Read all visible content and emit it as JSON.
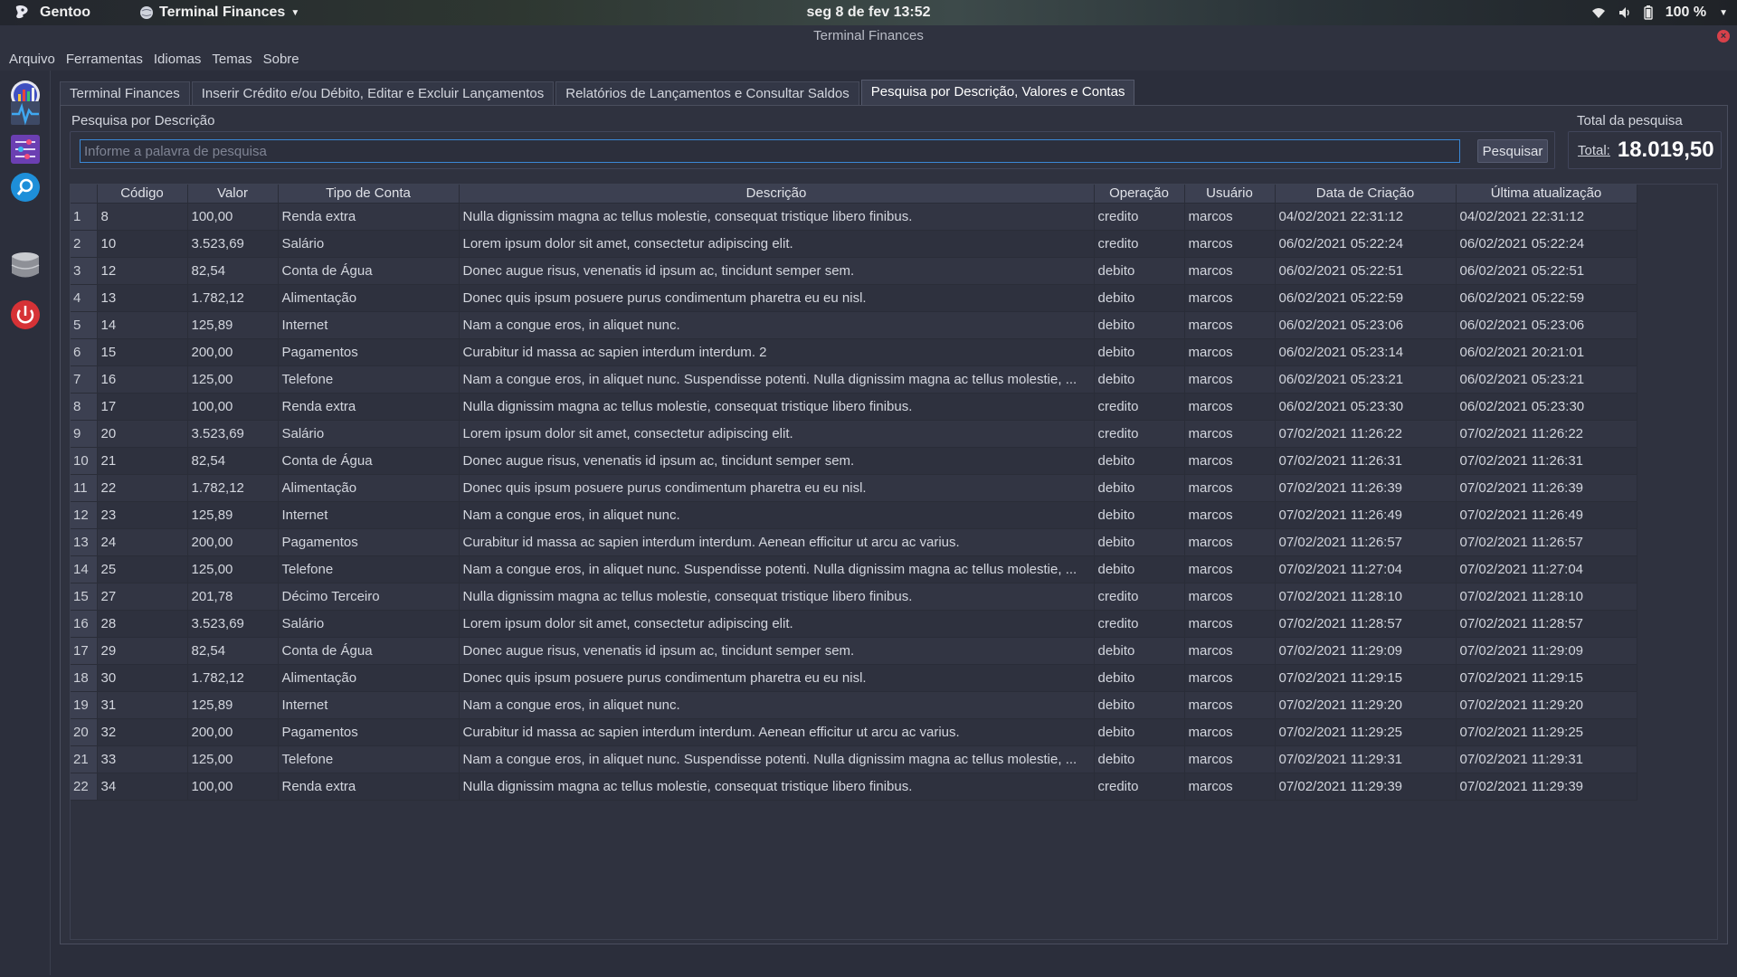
{
  "system": {
    "distro": "Gentoo",
    "app_menu": "Terminal Finances",
    "clock": "seg 8 de fev  13:52",
    "battery": "100 %"
  },
  "window": {
    "title": "Terminal Finances"
  },
  "menu": [
    "Arquivo",
    "Ferramentas",
    "Idiomas",
    "Temas",
    "Sobre"
  ],
  "sidebar_icons": [
    "dashboard-chart-icon",
    "pulse-icon",
    "settings-sliders-icon",
    "search-icon",
    "database-icon",
    "power-icon"
  ],
  "tabs": [
    {
      "label": "Terminal Finances",
      "active": false
    },
    {
      "label": "Inserir Crédito e/ou Débito, Editar e Excluir Lançamentos",
      "active": false
    },
    {
      "label": "Relatórios de Lançamentos e Consultar Saldos",
      "active": false
    },
    {
      "label": "Pesquisa por Descrição, Valores e Contas",
      "active": true
    }
  ],
  "search": {
    "group_label": "Pesquisa por Descrição",
    "placeholder": "Informe a palavra de pesquisa",
    "value": "",
    "button": "Pesquisar"
  },
  "total": {
    "group_label": "Total da pesquisa",
    "label": "Total:",
    "value": "18.019,50"
  },
  "table": {
    "columns": [
      "Código",
      "Valor",
      "Tipo de Conta",
      "Descrição",
      "Operação",
      "Usuário",
      "Data de Criação",
      "Última atualização"
    ],
    "rows": [
      [
        "8",
        "100,00",
        "Renda extra",
        "Nulla dignissim magna ac tellus molestie, consequat tristique libero finibus.",
        "credito",
        "marcos",
        "04/02/2021 22:31:12",
        "04/02/2021 22:31:12"
      ],
      [
        "10",
        "3.523,69",
        "Salário",
        "Lorem ipsum dolor sit amet, consectetur adipiscing elit.",
        "credito",
        "marcos",
        "06/02/2021 05:22:24",
        "06/02/2021 05:22:24"
      ],
      [
        "12",
        "82,54",
        "Conta de Água",
        "Donec augue risus, venenatis id ipsum ac, tincidunt semper sem.",
        "debito",
        "marcos",
        "06/02/2021 05:22:51",
        "06/02/2021 05:22:51"
      ],
      [
        "13",
        "1.782,12",
        "Alimentação",
        "Donec quis ipsum posuere purus condimentum pharetra eu eu nisl.",
        "debito",
        "marcos",
        "06/02/2021 05:22:59",
        "06/02/2021 05:22:59"
      ],
      [
        "14",
        "125,89",
        "Internet",
        "Nam a congue eros, in aliquet nunc.",
        "debito",
        "marcos",
        "06/02/2021 05:23:06",
        "06/02/2021 05:23:06"
      ],
      [
        "15",
        "200,00",
        "Pagamentos",
        "Curabitur id massa ac sapien interdum interdum.  2",
        "debito",
        "marcos",
        "06/02/2021 05:23:14",
        "06/02/2021 20:21:01"
      ],
      [
        "16",
        "125,00",
        "Telefone",
        "Nam a congue eros, in aliquet nunc. Suspendisse potenti. Nulla dignissim magna ac tellus molestie, ...",
        "debito",
        "marcos",
        "06/02/2021 05:23:21",
        "06/02/2021 05:23:21"
      ],
      [
        "17",
        "100,00",
        "Renda extra",
        "Nulla dignissim magna ac tellus molestie, consequat tristique libero finibus.",
        "credito",
        "marcos",
        "06/02/2021 05:23:30",
        "06/02/2021 05:23:30"
      ],
      [
        "20",
        "3.523,69",
        "Salário",
        "Lorem ipsum dolor sit amet, consectetur adipiscing elit.",
        "credito",
        "marcos",
        "07/02/2021 11:26:22",
        "07/02/2021 11:26:22"
      ],
      [
        "21",
        "82,54",
        "Conta de Água",
        "Donec augue risus, venenatis id ipsum ac, tincidunt semper sem.",
        "debito",
        "marcos",
        "07/02/2021 11:26:31",
        "07/02/2021 11:26:31"
      ],
      [
        "22",
        "1.782,12",
        "Alimentação",
        "Donec quis ipsum posuere purus condimentum pharetra eu eu nisl.",
        "debito",
        "marcos",
        "07/02/2021 11:26:39",
        "07/02/2021 11:26:39"
      ],
      [
        "23",
        "125,89",
        "Internet",
        "Nam a congue eros, in aliquet nunc.",
        "debito",
        "marcos",
        "07/02/2021 11:26:49",
        "07/02/2021 11:26:49"
      ],
      [
        "24",
        "200,00",
        "Pagamentos",
        "Curabitur id massa ac sapien interdum interdum. Aenean efficitur ut arcu ac varius.",
        "debito",
        "marcos",
        "07/02/2021 11:26:57",
        "07/02/2021 11:26:57"
      ],
      [
        "25",
        "125,00",
        "Telefone",
        "Nam a congue eros, in aliquet nunc. Suspendisse potenti. Nulla dignissim magna ac tellus molestie, ...",
        "debito",
        "marcos",
        "07/02/2021 11:27:04",
        "07/02/2021 11:27:04"
      ],
      [
        "27",
        "201,78",
        "Décimo Terceiro",
        "Nulla dignissim magna ac tellus molestie, consequat tristique libero finibus.",
        "credito",
        "marcos",
        "07/02/2021 11:28:10",
        "07/02/2021 11:28:10"
      ],
      [
        "28",
        "3.523,69",
        "Salário",
        "Lorem ipsum dolor sit amet, consectetur adipiscing elit.",
        "credito",
        "marcos",
        "07/02/2021 11:28:57",
        "07/02/2021 11:28:57"
      ],
      [
        "29",
        "82,54",
        "Conta de Água",
        "Donec augue risus, venenatis id ipsum ac, tincidunt semper sem.",
        "debito",
        "marcos",
        "07/02/2021 11:29:09",
        "07/02/2021 11:29:09"
      ],
      [
        "30",
        "1.782,12",
        "Alimentação",
        "Donec quis ipsum posuere purus condimentum pharetra eu eu nisl.",
        "debito",
        "marcos",
        "07/02/2021 11:29:15",
        "07/02/2021 11:29:15"
      ],
      [
        "31",
        "125,89",
        "Internet",
        "Nam a congue eros, in aliquet nunc.",
        "debito",
        "marcos",
        "07/02/2021 11:29:20",
        "07/02/2021 11:29:20"
      ],
      [
        "32",
        "200,00",
        "Pagamentos",
        "Curabitur id massa ac sapien interdum interdum. Aenean efficitur ut arcu ac varius.",
        "debito",
        "marcos",
        "07/02/2021 11:29:25",
        "07/02/2021 11:29:25"
      ],
      [
        "33",
        "125,00",
        "Telefone",
        "Nam a congue eros, in aliquet nunc. Suspendisse potenti. Nulla dignissim magna ac tellus molestie, ...",
        "debito",
        "marcos",
        "07/02/2021 11:29:31",
        "07/02/2021 11:29:31"
      ],
      [
        "34",
        "100,00",
        "Renda extra",
        "Nulla dignissim magna ac tellus molestie, consequat tristique libero finibus.",
        "credito",
        "marcos",
        "07/02/2021 11:29:39",
        "07/02/2021 11:29:39"
      ]
    ]
  }
}
